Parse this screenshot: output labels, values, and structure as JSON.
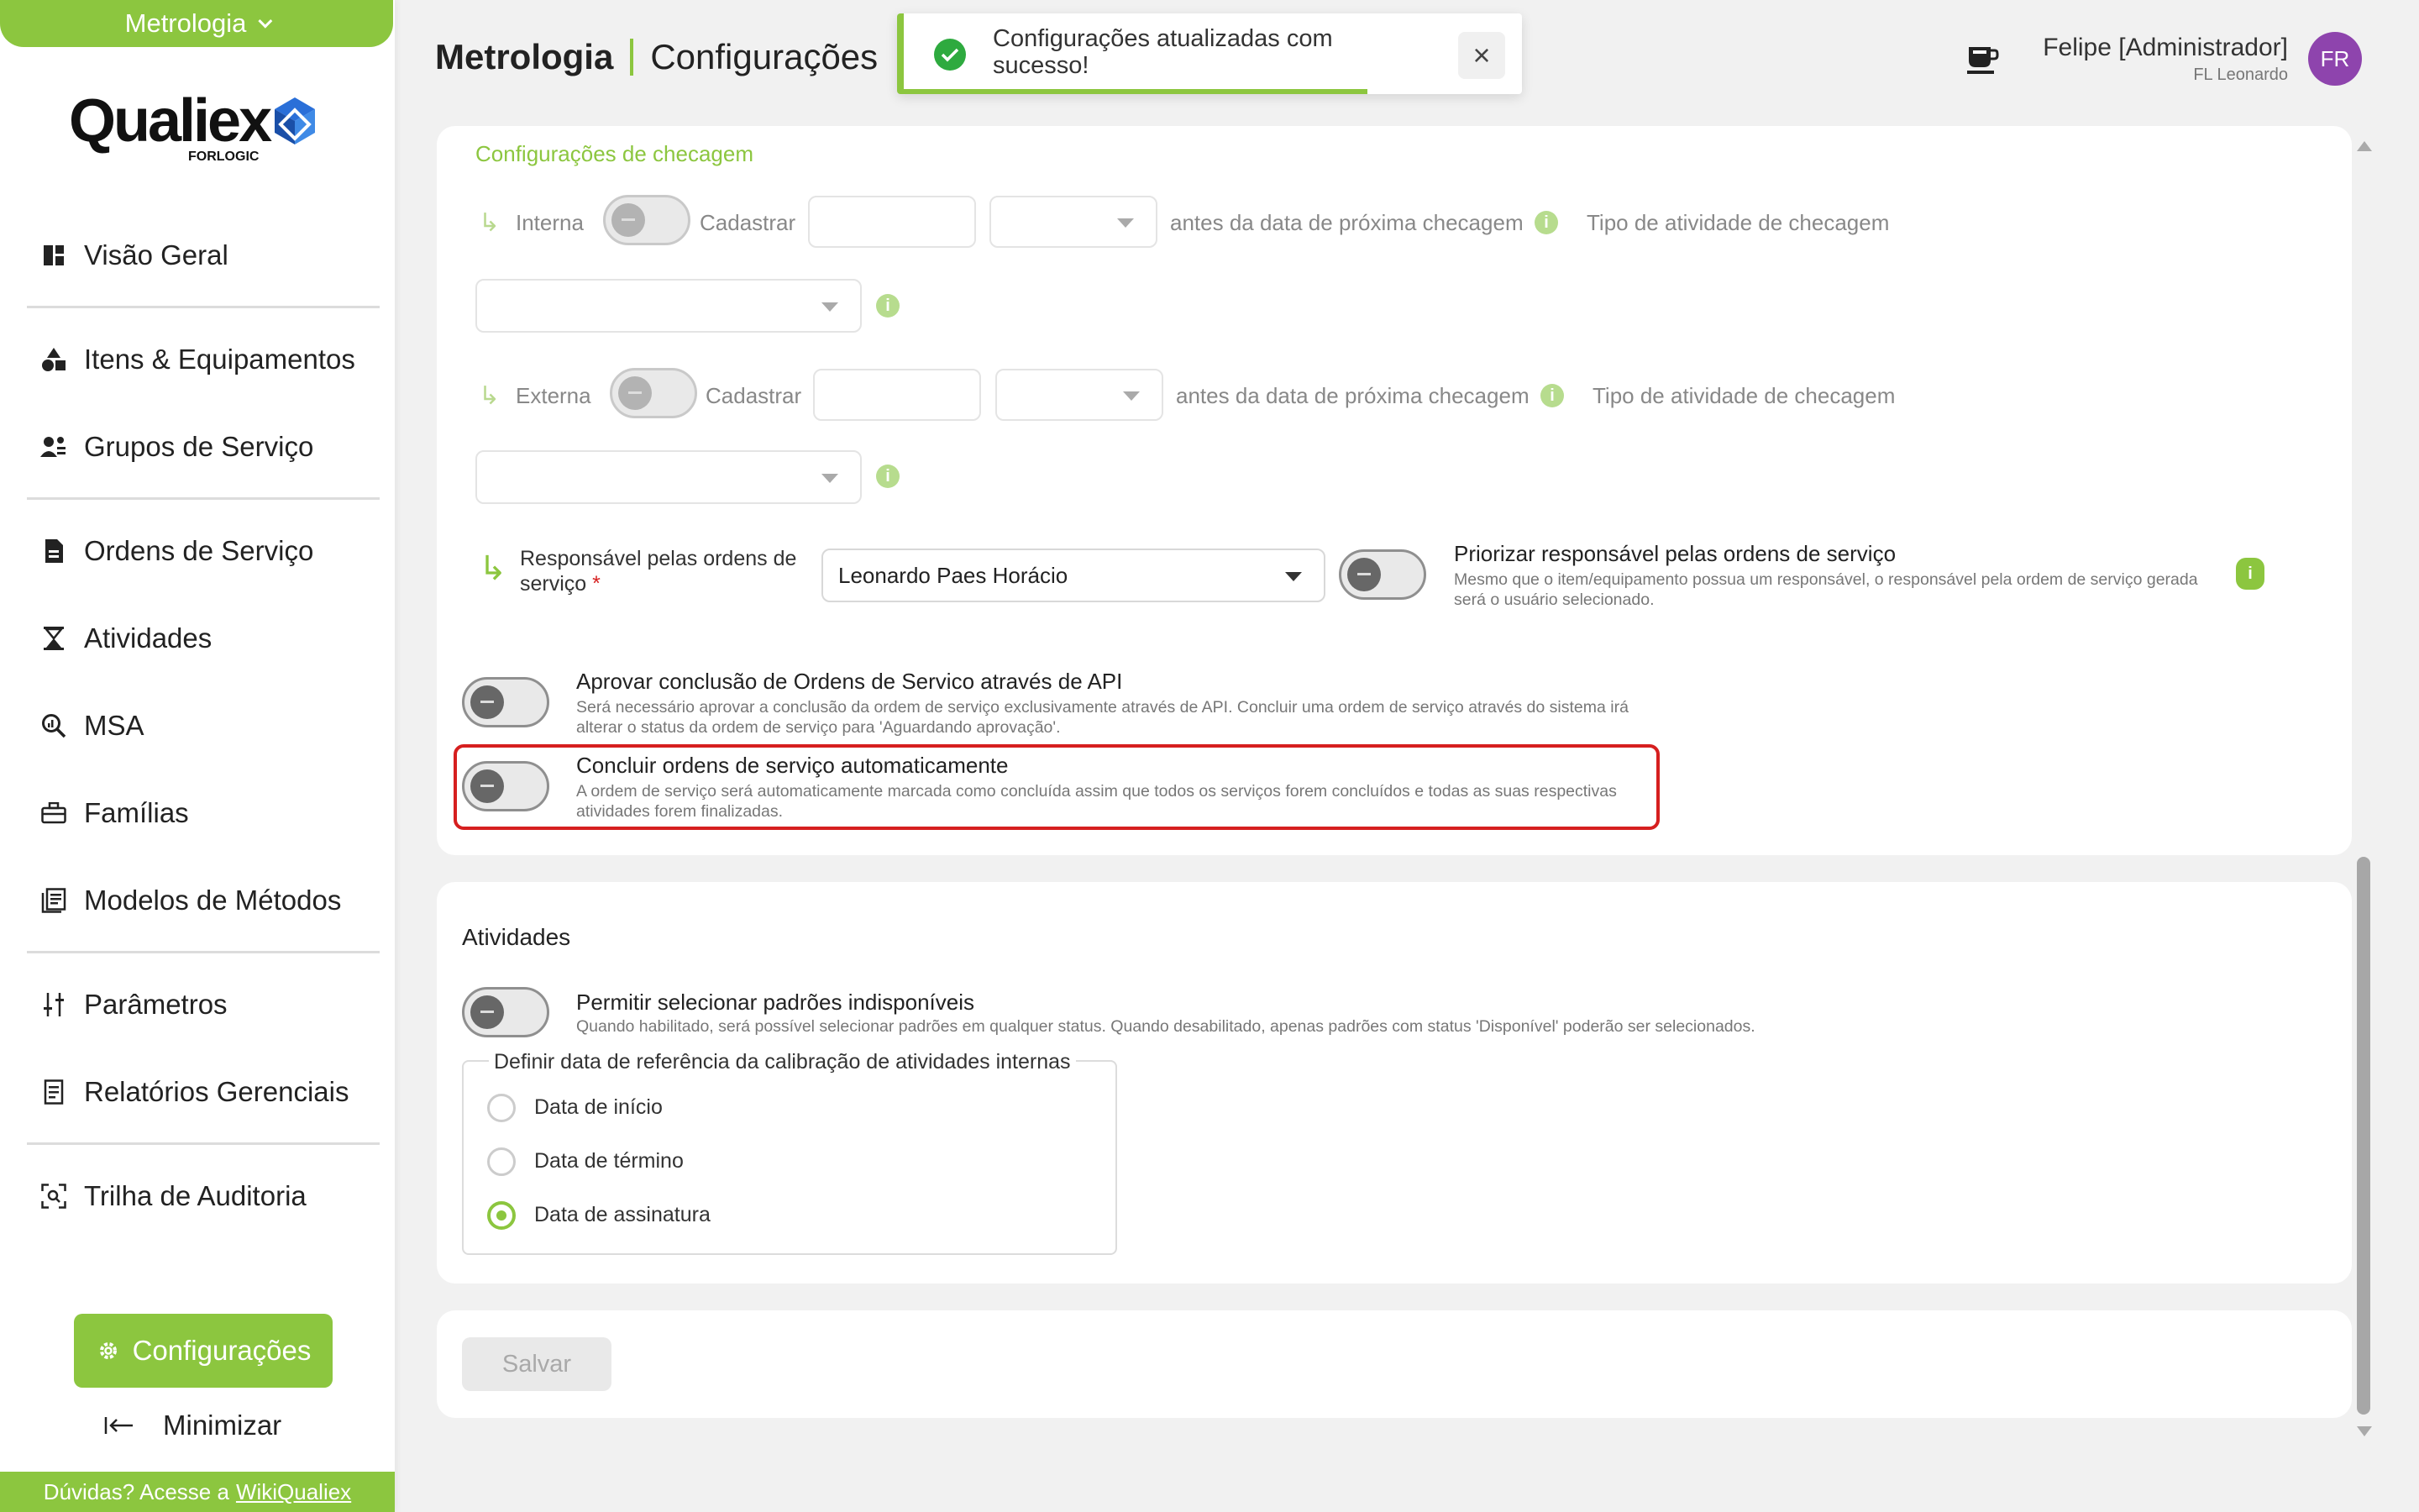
{
  "sidebar": {
    "module_label": "Metrologia",
    "logo_text": "Qualiex",
    "logo_sub": "FORLOGIC",
    "items": [
      {
        "label": "Visão Geral",
        "icon": "dashboard-icon"
      },
      {
        "label": "Itens & Equipamentos",
        "icon": "shapes-icon"
      },
      {
        "label": "Grupos de Serviço",
        "icon": "user-group-icon"
      },
      {
        "label": "Ordens de Serviço",
        "icon": "document-icon"
      },
      {
        "label": "Atividades",
        "icon": "hourglass-icon"
      },
      {
        "label": "MSA",
        "icon": "search-chart-icon"
      },
      {
        "label": "Famílias",
        "icon": "toolbox-icon"
      },
      {
        "label": "Modelos de Métodos",
        "icon": "book-icon"
      },
      {
        "label": "Parâmetros",
        "icon": "sliders-icon"
      },
      {
        "label": "Relatórios Gerenciais",
        "icon": "report-icon"
      },
      {
        "label": "Trilha de Auditoria",
        "icon": "audit-scan-icon"
      }
    ],
    "config_label": "Configurações",
    "minimize_label": "Minimizar",
    "help_text": "Dúvidas? Acesse a",
    "help_link": "WikiQualiex"
  },
  "header": {
    "module": "Metrologia",
    "page": "Configurações",
    "user_name": "Felipe [Administrador]",
    "user_sub": "FL Leonardo",
    "avatar_initials": "FR"
  },
  "toast": {
    "message": "Configurações atualizadas com sucesso!",
    "progress": 0.75
  },
  "checagem": {
    "title": "Configurações de checagem",
    "interna": {
      "label": "Interna",
      "cadastrar": "Cadastrar",
      "antes": "antes da data de próxima checagem",
      "tipo": "Tipo de atividade de checagem"
    },
    "externa": {
      "label": "Externa",
      "cadastrar": "Cadastrar",
      "antes": "antes da data de próxima checagem",
      "tipo": "Tipo de atividade de checagem"
    },
    "responsavel": {
      "label": "Responsável pelas ordens de serviço",
      "required_mark": "*",
      "value": "Leonardo Paes Horácio",
      "priorizar_title": "Priorizar responsável pelas ordens de serviço",
      "priorizar_desc": "Mesmo que o item/equipamento possua um responsável, o responsável pela ordem de serviço gerada será o usuário selecionado."
    },
    "aprovar": {
      "title": "Aprovar conclusão de Ordens de Servico através de API",
      "desc": "Será necessário aprovar a conclusão da ordem de serviço exclusivamente através de API. Concluir uma ordem de serviço através do sistema irá alterar o status da ordem de serviço para 'Aguardando aprovação'."
    },
    "concluir": {
      "title": "Concluir ordens de serviço automaticamente",
      "desc": "A ordem de serviço será automaticamente marcada como concluída assim que todos os serviços forem concluídos e todas as suas respectivas atividades forem finalizadas."
    }
  },
  "atividades": {
    "title": "Atividades",
    "permitir_title": "Permitir selecionar padrões indisponíveis",
    "permitir_desc": "Quando habilitado, será possível selecionar padrões em qualquer status. Quando desabilitado, apenas padrões com status 'Disponível' poderão ser selecionados.",
    "fieldset_label": "Definir data de referência da calibração de atividades internas",
    "options": [
      "Data de início",
      "Data de término",
      "Data de assinatura"
    ],
    "selected": "Data de assinatura"
  },
  "save_label": "Salvar",
  "colors": {
    "brand_green": "#8cc63f",
    "highlight_red": "#d61f1f",
    "avatar_purple": "#8e44ad"
  }
}
